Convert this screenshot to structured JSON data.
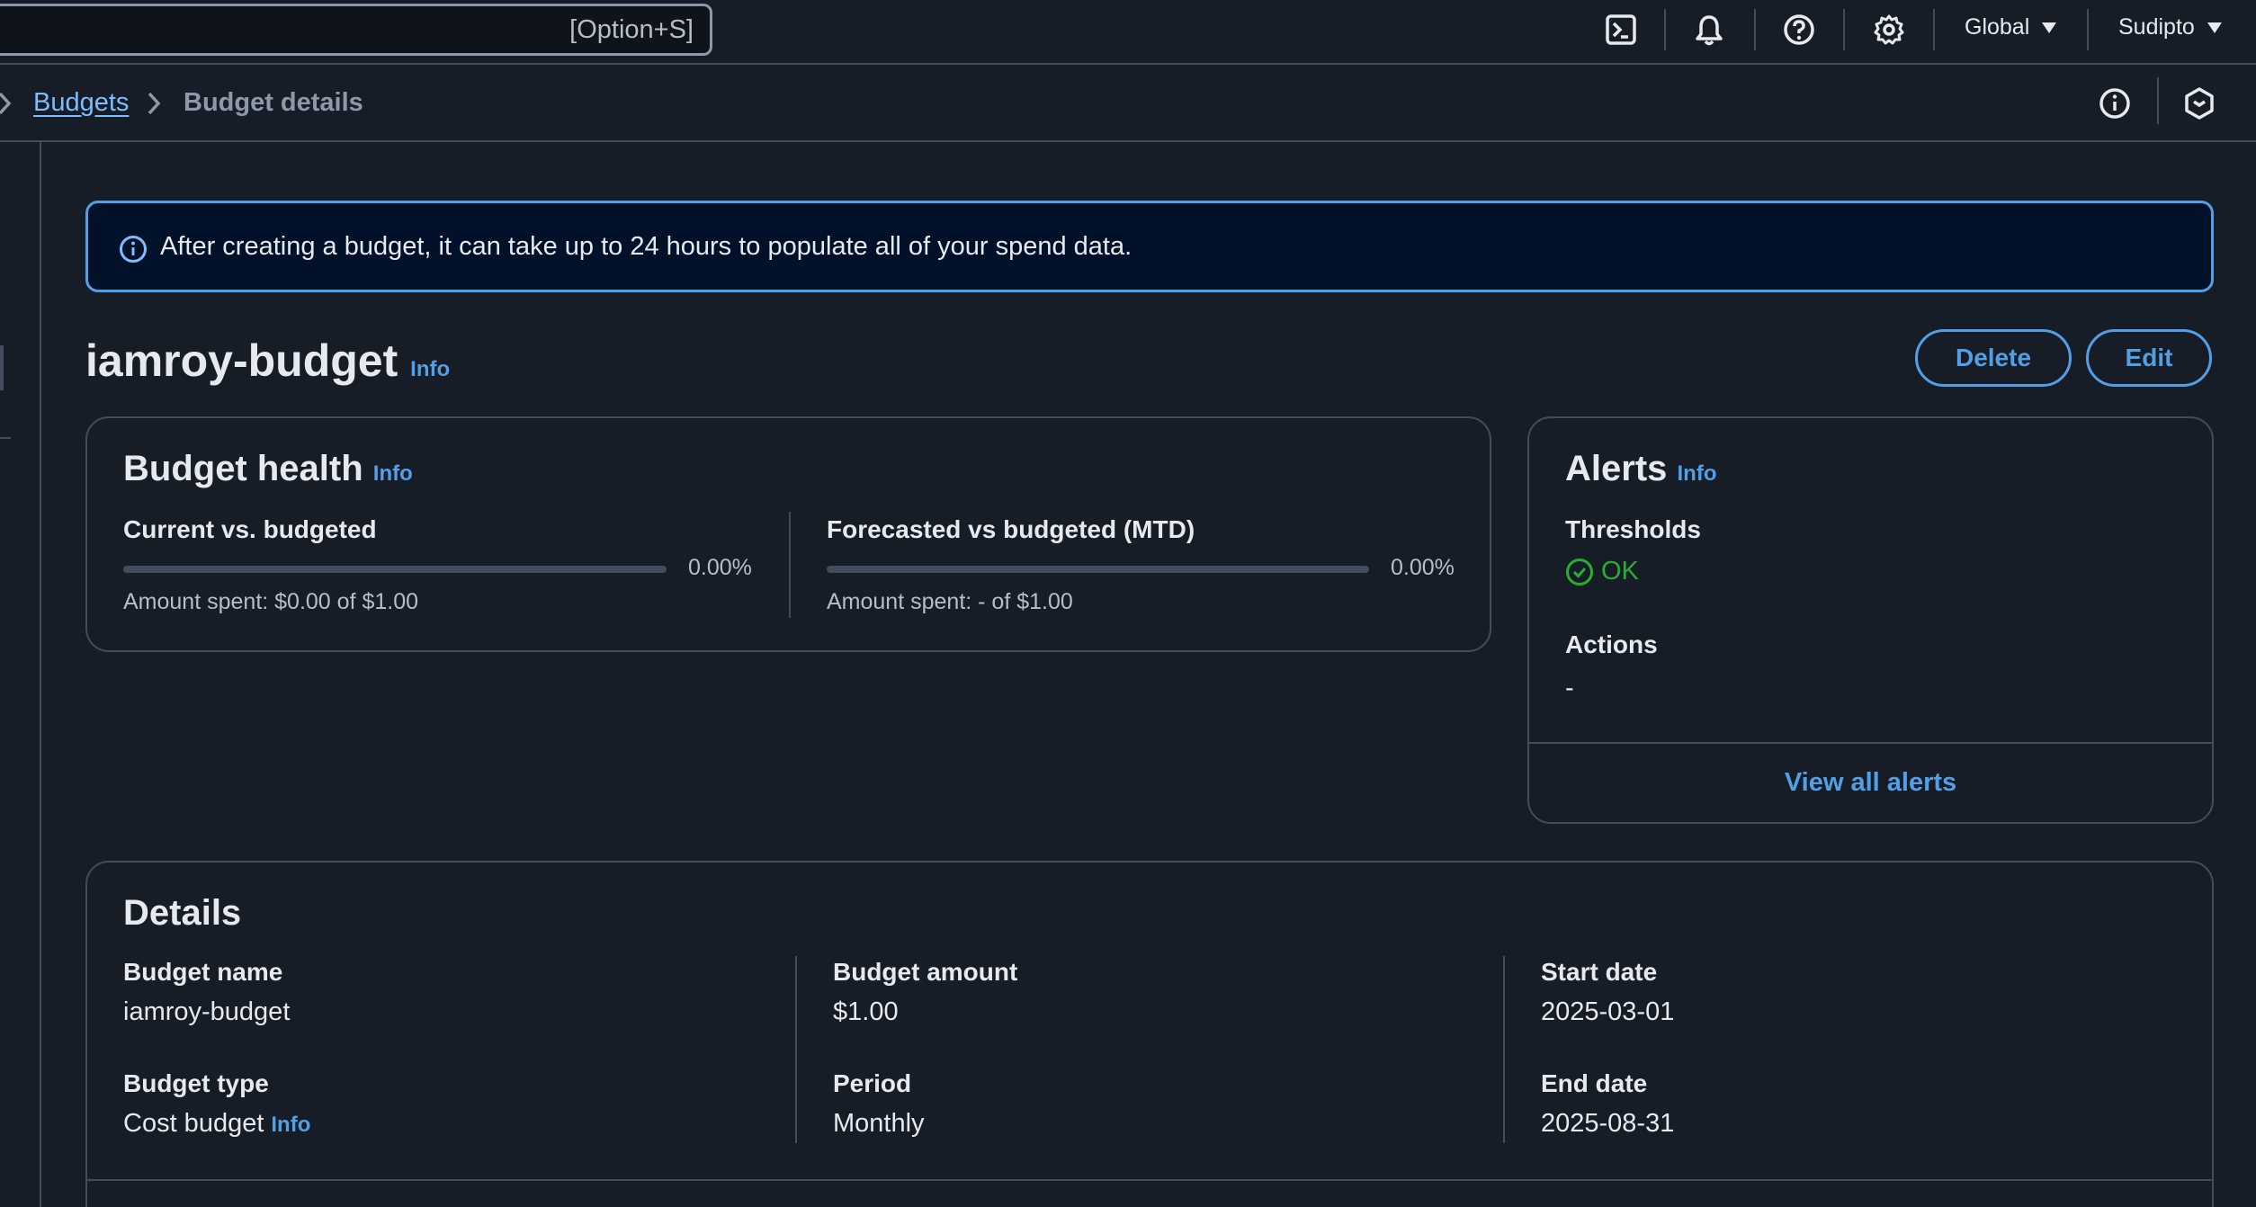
{
  "topnav": {
    "search_shortcut": "[Option+S]",
    "region": "Global",
    "user": "Sudipto"
  },
  "breadcrumb": {
    "parent": "Budgets",
    "current": "Budget details"
  },
  "flash": {
    "message": "After creating a budget, it can take up to 24 hours to populate all of your spend data."
  },
  "header": {
    "title": "iamroy-budget",
    "info": "Info",
    "delete_label": "Delete",
    "edit_label": "Edit"
  },
  "budget_health": {
    "title": "Budget health",
    "info": "Info",
    "current": {
      "label": "Current vs. budgeted",
      "percent_text": "0.00%",
      "progress": 0,
      "amount_text": "Amount spent: $0.00 of $1.00"
    },
    "forecasted": {
      "label": "Forecasted vs budgeted (MTD)",
      "percent_text": "0.00%",
      "progress": 0,
      "amount_text": "Amount spent: - of $1.00"
    }
  },
  "alerts": {
    "title": "Alerts",
    "info": "Info",
    "thresholds_label": "Thresholds",
    "thresholds_status": "OK",
    "actions_label": "Actions",
    "actions_value": "-",
    "view_all_label": "View all alerts"
  },
  "details": {
    "title": "Details",
    "budget_name_label": "Budget name",
    "budget_name": "iamroy-budget",
    "budget_type_label": "Budget type",
    "budget_type": "Cost budget",
    "budget_type_info": "Info",
    "budget_amount_label": "Budget amount",
    "budget_amount": "$1.00",
    "period_label": "Period",
    "period": "Monthly",
    "start_date_label": "Start date",
    "start_date": "2025-03-01",
    "end_date_label": "End date",
    "end_date": "2025-08-31"
  },
  "colors": {
    "background": "#161d26",
    "accent": "#539fe5",
    "success": "#29ad32",
    "flash_bg": "#001129"
  }
}
